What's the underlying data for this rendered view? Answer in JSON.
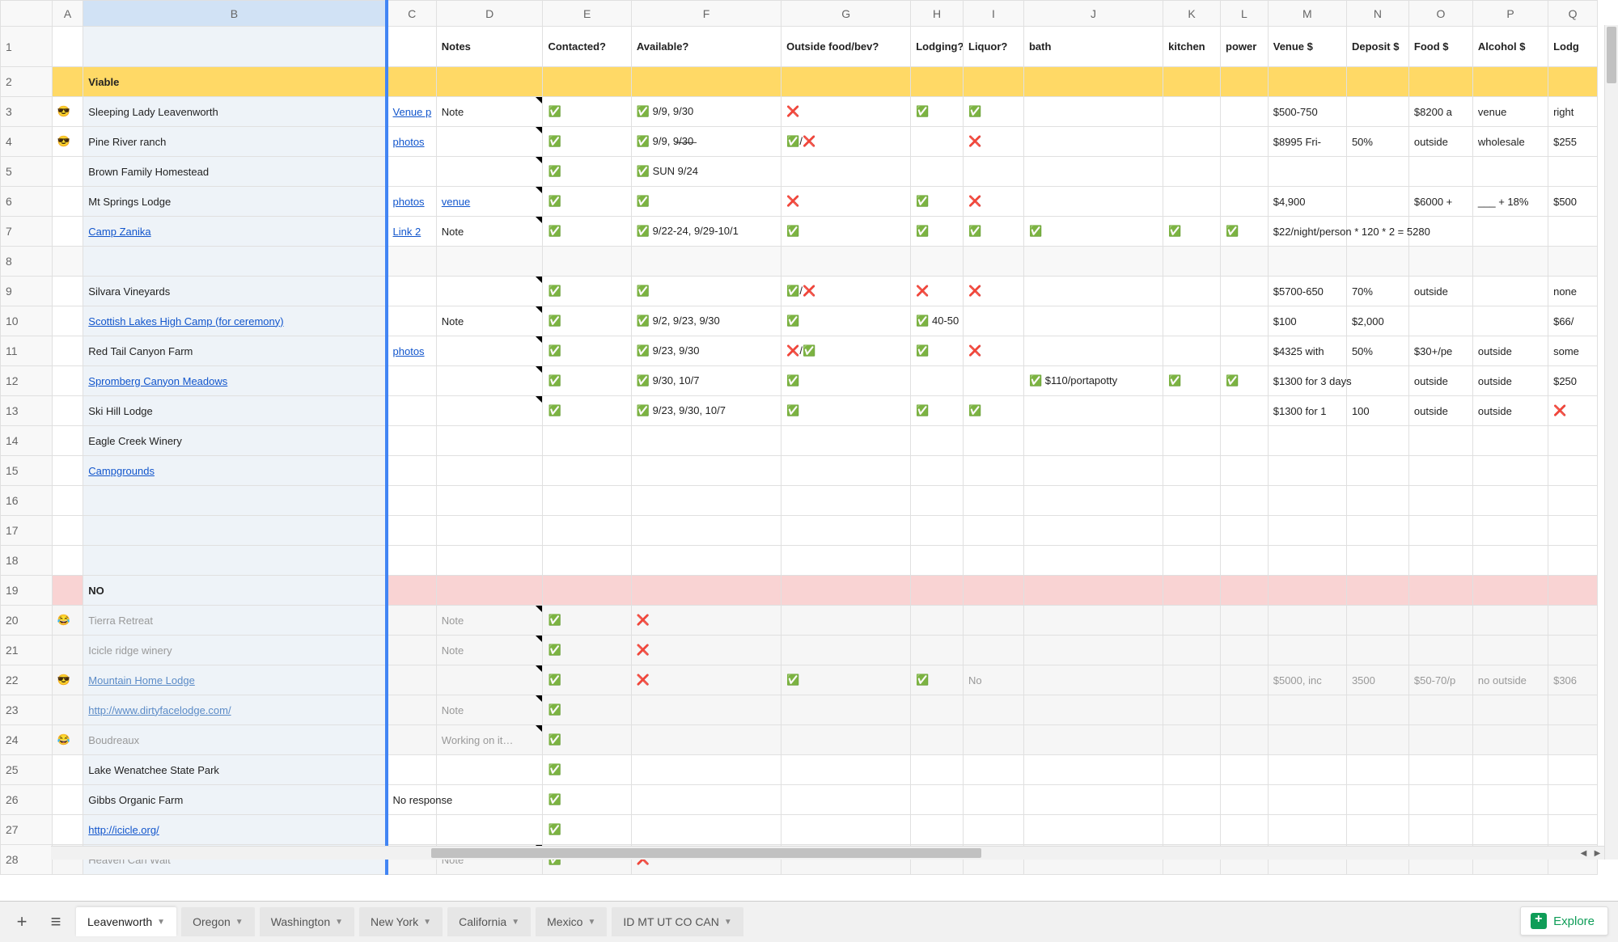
{
  "columns": [
    "",
    "A",
    "B",
    "C",
    "D",
    "E",
    "F",
    "G",
    "H",
    "I",
    "J",
    "K",
    "L",
    "M",
    "N",
    "O",
    "P",
    "Q"
  ],
  "headers": {
    "D": "Notes",
    "E": "Contacted?",
    "F": "Available?",
    "G": "Outside food/bev?",
    "H": "Lodging?",
    "I": "Liquor?",
    "J": "bath",
    "K": "kitchen",
    "L": "power",
    "M": "Venue $",
    "N": "Deposit $",
    "O": "Food $",
    "P": "Alcohol $",
    "Q": "Lodg"
  },
  "section_viable": "Viable",
  "section_no": "NO",
  "rows": {
    "3": {
      "A": "😎",
      "B": "Sleeping Lady Leavenworth",
      "C": "Venue p",
      "C_link": true,
      "D": "Note",
      "D_note": true,
      "E": "✅",
      "F": "✅ 9/9, 9/30",
      "G": "❌",
      "H": "✅",
      "I": "✅",
      "M": "$500-750",
      "O": "$8200 a",
      "P": "venue",
      "Q": "right"
    },
    "4": {
      "A": "😎",
      "B": "Pine River ranch",
      "C": "photos",
      "C_link": true,
      "D_note": true,
      "E": "✅",
      "F": "✅ 9/9, 9̶/̶3̶0̶",
      "G": "✅/❌",
      "I": "❌",
      "M": "$8995 Fri-",
      "N": "50%",
      "O": "outside",
      "P": "wholesale",
      "Q": "$255"
    },
    "5": {
      "B": "Brown Family Homestead",
      "D_note": true,
      "E": "✅",
      "F": "✅ SUN 9/24"
    },
    "6": {
      "B": "Mt Springs Lodge",
      "C": "photos",
      "C_link": true,
      "D": "venue",
      "D_link": true,
      "D_note": true,
      "E": "✅",
      "F": "✅",
      "G": "❌",
      "H": "✅",
      "I": "❌",
      "M": "$4,900",
      "O": "$6000 +",
      "P": "___ + 18%",
      "Q": "$500"
    },
    "7": {
      "B": "Camp Zanika",
      "B_link": true,
      "C": "Link 2",
      "C_link": true,
      "D": "Note",
      "D_note": true,
      "E": "✅",
      "F": "✅ 9/22-24, 9/29-10/1",
      "G": "✅",
      "H": "✅",
      "I": "✅",
      "J": "✅",
      "K": "✅",
      "L": "✅",
      "M": "$22/night/person * 120 * 2 = 5280"
    },
    "9": {
      "B": "Silvara Vineyards",
      "D_note": true,
      "E": "✅",
      "F": "✅",
      "G": "✅/❌",
      "H": "❌",
      "I": "❌",
      "M": "$5700-650",
      "N": "70%",
      "O": "outside",
      "Q": "none"
    },
    "10": {
      "B": "Scottish Lakes High Camp (for ceremony)",
      "B_link": true,
      "D": "Note",
      "D_note": true,
      "E": "✅",
      "F": "✅ 9/2, 9/23, 9/30",
      "G": "✅",
      "H": "✅ 40-50",
      "M": "$100",
      "N": "$2,000",
      "Q": "$66/"
    },
    "11": {
      "B": "Red Tail Canyon Farm",
      "C": "photos",
      "C_link": true,
      "D_note": true,
      "E": "✅",
      "F": "✅ 9/23, 9/30",
      "G": "❌/✅",
      "H": "✅",
      "I": "❌",
      "M": "$4325 with",
      "N": "50%",
      "O": "$30+/pe",
      "P": "outside",
      "Q": "some"
    },
    "12": {
      "B": "Spromberg Canyon Meadows",
      "B_link": true,
      "D_note": true,
      "E": "✅",
      "F": "✅ 9/30, 10/7",
      "G": "✅",
      "J": "✅ $110/portapotty",
      "K": "✅",
      "L": "✅",
      "M": "$1300 for 3 days",
      "O": "outside",
      "P": "outside",
      "Q": "$250"
    },
    "13": {
      "B": "Ski Hill Lodge",
      "D_note": true,
      "E": "✅",
      "F": "✅ 9/23, 9/30, 10/7",
      "G": "✅",
      "H": "✅",
      "I": "✅",
      "M": "$1300 for 1",
      "N": "100",
      "O": "outside",
      "P": "outside",
      "Q": "❌"
    },
    "14": {
      "B": "Eagle Creek Winery"
    },
    "15": {
      "B": "Campgrounds",
      "B_link": true
    },
    "20": {
      "A": "😂",
      "B": "Tierra Retreat",
      "D": "Note",
      "D_note": true,
      "E": "✅",
      "F": "❌",
      "gray": true
    },
    "21": {
      "B": "Icicle ridge winery",
      "D": "Note",
      "D_note": true,
      "E": "✅",
      "F": "❌",
      "gray": true
    },
    "22": {
      "A": "😎",
      "B": "Mountain Home Lodge",
      "B_link": true,
      "D_note": true,
      "E": "✅",
      "F": "❌",
      "G": "✅",
      "H": "✅",
      "I": "No",
      "M": "$5000, inc",
      "N": "3500",
      "O": "$50-70/p",
      "P": "no outside",
      "Q": "$306",
      "gray": true
    },
    "23": {
      "B": "http://www.dirtyfacelodge.com/",
      "B_link": true,
      "D": "Note",
      "D_note": true,
      "E": "✅",
      "gray": true
    },
    "24": {
      "A": "😂",
      "B": "Boudreaux",
      "D": "Working on it…",
      "D_note": true,
      "E": "✅",
      "gray": true
    },
    "25": {
      "B": "Lake Wenatchee State Park",
      "E": "✅"
    },
    "26": {
      "B": "Gibbs Organic Farm",
      "C": "No response",
      "C_overflow": true,
      "E": "✅"
    },
    "27": {
      "B": "http://icicle.org/",
      "B_link": true,
      "E": "✅"
    },
    "28": {
      "B": "Heaven Can Wait",
      "D": "Note",
      "D_note": true,
      "E": "✅",
      "F": "❌",
      "gray": true
    }
  },
  "tabs": [
    {
      "name": "Leavenworth",
      "active": true
    },
    {
      "name": "Oregon"
    },
    {
      "name": "Washington"
    },
    {
      "name": "New York"
    },
    {
      "name": "California"
    },
    {
      "name": "Mexico"
    },
    {
      "name": "ID MT UT CO CAN"
    }
  ],
  "explore_label": "Explore"
}
